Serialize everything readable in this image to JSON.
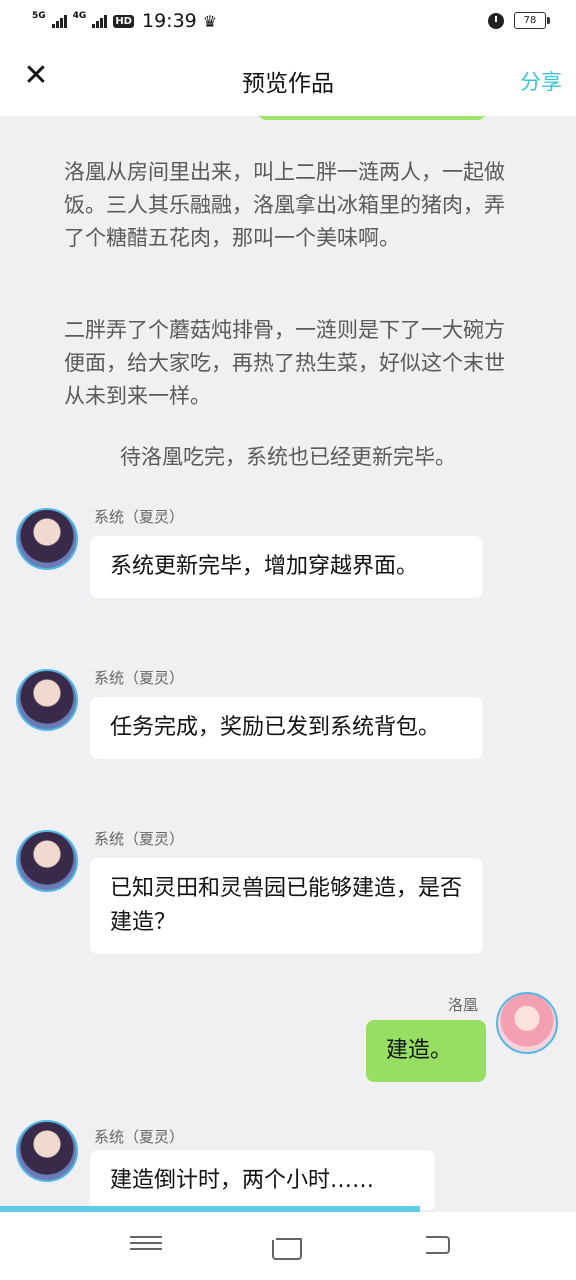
{
  "status_bar": {
    "net1": "5G",
    "net2": "4G",
    "hd": "HD",
    "time": "19:39",
    "battery": "78"
  },
  "nav": {
    "title": "预览作品",
    "share": "分享"
  },
  "narration": [
    "洛凰从房间里出来，叫上二胖一涟两人，一起做饭。三人其乐融融，洛凰拿出冰箱里的猪肉，弄了个糖醋五花肉，那叫一个美味啊。",
    "二胖弄了个蘑菇炖排骨，一涟则是下了一大碗方便面，给大家吃，再热了热生菜，好似这个末世从未到来一样。",
    "待洛凰吃完，系统也已经更新完毕。"
  ],
  "messages": [
    {
      "sender": "系统（夏灵）",
      "text": "系统更新完毕，增加穿越界面。"
    },
    {
      "sender": "系统（夏灵）",
      "text": "任务完成，奖励已发到系统背包。"
    },
    {
      "sender": "系统（夏灵）",
      "text": "已知灵田和灵兽园已能够建造，是否建造？"
    },
    {
      "sender": "洛凰",
      "text": "建造。"
    },
    {
      "sender": "系统（夏灵）",
      "text": "建造倒计时，两个小时……"
    }
  ],
  "colors": {
    "accent": "#3fc4d8",
    "my_bubble": "#96df62",
    "background": "#f0f0f2"
  }
}
